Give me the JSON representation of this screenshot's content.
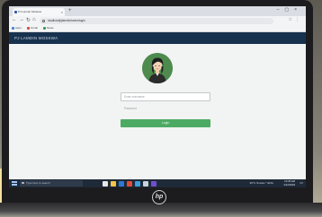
{
  "browser": {
    "tab_title": "PJ Lamdin Moskwa",
    "url": "localhost/pjlamdin/users/login",
    "bookmarks": [
      "Apps",
      "Gmail",
      "News"
    ]
  },
  "app": {
    "title": "PJ LAMDIN MOSKWA"
  },
  "login": {
    "username_placeholder": "Enter username",
    "password_placeholder": "Password",
    "button_label": "Login"
  },
  "taskbar": {
    "search_placeholder": "Type here to search",
    "tray_text": "30°C Smoke  ^  ENG",
    "time": "10:45 AM",
    "date": "2/12/2023"
  },
  "device": {
    "brand": "hp"
  },
  "colors": {
    "app_bar": "#17324e",
    "login_button": "#4caa63",
    "avatar_bg": "#4e8a4e"
  }
}
